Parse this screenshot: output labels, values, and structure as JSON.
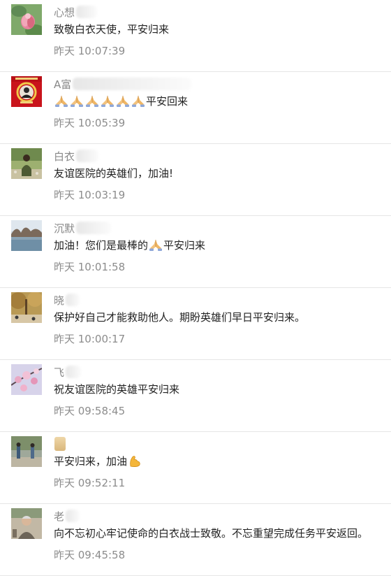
{
  "comments": [
    {
      "name": "心想",
      "content": "致敬白衣天使，平安归来",
      "time": "昨天 10:07:39"
    },
    {
      "name": "A富",
      "content_suffix": "平安回来",
      "time": "昨天 10:05:39"
    },
    {
      "name": "白衣",
      "content": "友谊医院的英雄们，加油!",
      "time": "昨天 10:03:19"
    },
    {
      "name": "沉默",
      "content_prefix": "加油！您们是最棒的",
      "content_suffix": "平安归来",
      "time": "昨天 10:01:58"
    },
    {
      "name": "晓",
      "content": "保护好自己才能救助他人。期盼英雄们早日平安归来。",
      "time": "昨天 10:00:17"
    },
    {
      "name": "飞",
      "content": "祝友谊医院的英雄平安归来",
      "time": "昨天 09:58:45"
    },
    {
      "name": "",
      "content_prefix": "平安归来，加油",
      "time": "昨天 09:52:11"
    },
    {
      "name": "老",
      "content": "向不忘初心牢记使命的白衣战士致敬。不忘重望完成任务平安返回。",
      "time": "昨天 09:45:58"
    }
  ],
  "icons": {
    "praying_hands": "folded-hands-emoji",
    "flexed_biceps": "flexed-biceps-emoji"
  }
}
